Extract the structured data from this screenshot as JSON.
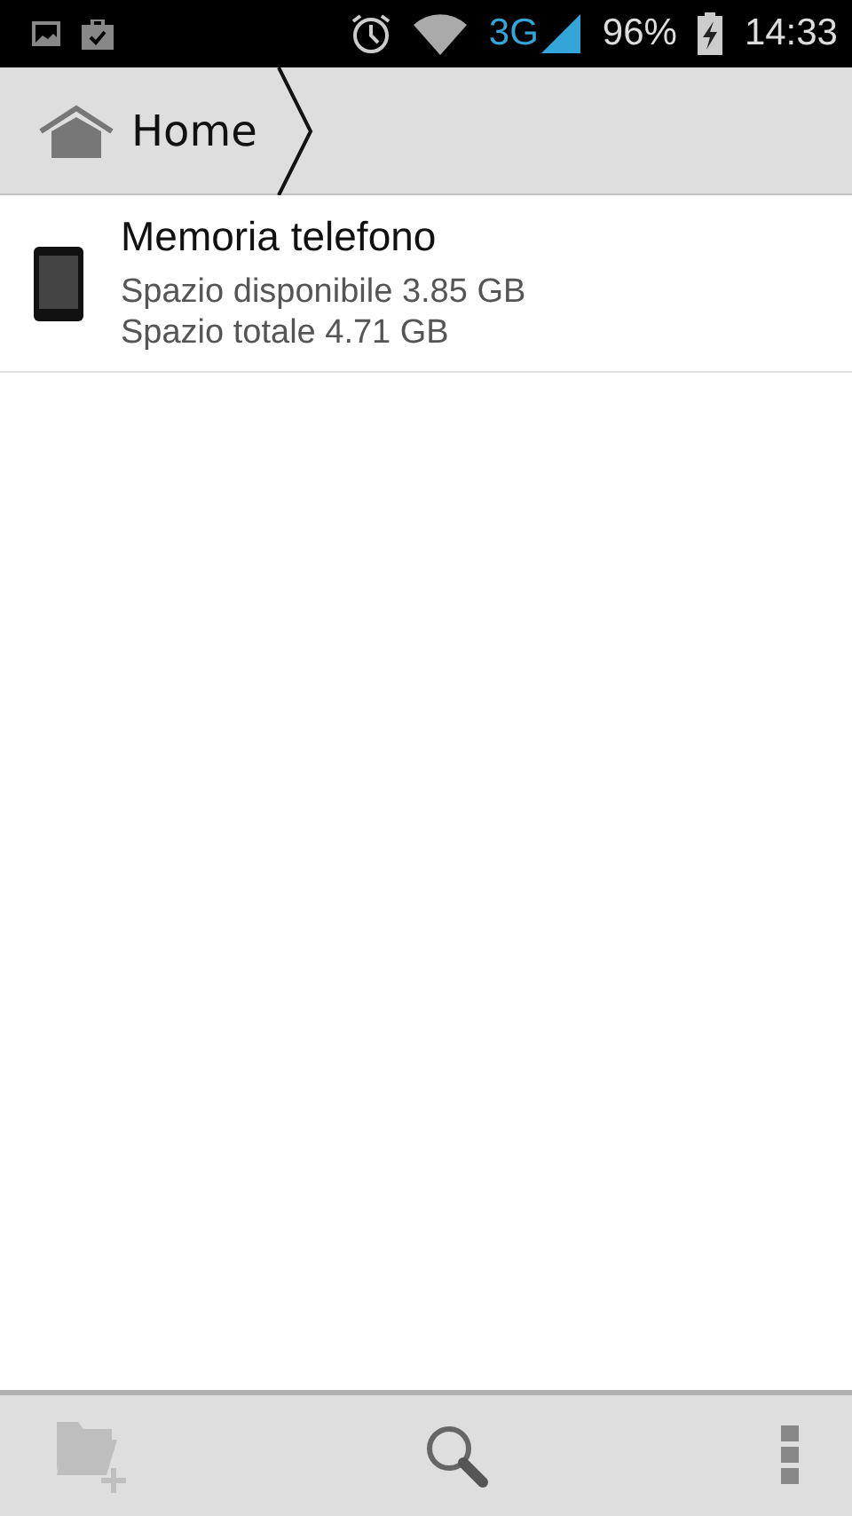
{
  "status_bar": {
    "network": "3G",
    "battery": "96%",
    "time": "14:33"
  },
  "breadcrumb": [
    {
      "label": "Home"
    }
  ],
  "storage": [
    {
      "name": "Memoria telefono",
      "available": "Spazio disponibile 3.85 GB",
      "total": "Spazio totale 4.71 GB"
    }
  ],
  "toolbar": [
    {
      "kind": "new-folder",
      "disabled": true
    },
    {
      "kind": "search",
      "disabled": false
    },
    {
      "kind": "overflow",
      "disabled": false
    }
  ]
}
